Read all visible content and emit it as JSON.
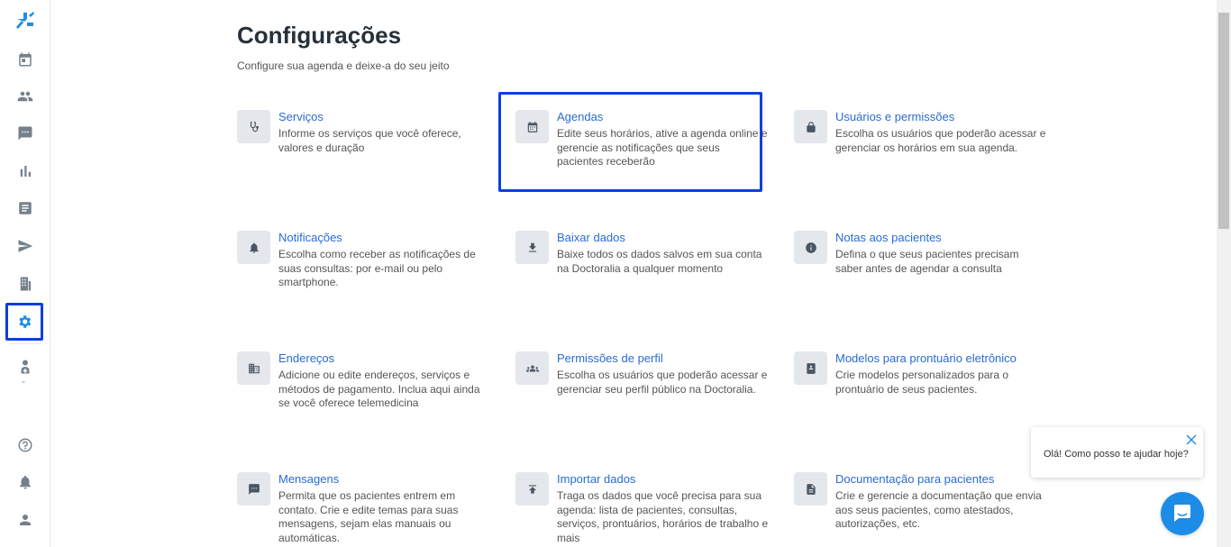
{
  "app": {
    "logo": "doctoralia-logo"
  },
  "sidebar": {
    "items": [
      {
        "icon": "logo-icon"
      },
      {
        "icon": "calendar-icon"
      },
      {
        "icon": "patients-icon"
      },
      {
        "icon": "messages-icon"
      },
      {
        "icon": "stats-icon"
      },
      {
        "icon": "records-icon"
      },
      {
        "icon": "send-icon"
      },
      {
        "icon": "building-icon"
      },
      {
        "icon": "settings-icon",
        "active": true
      },
      {
        "icon": "doctor-icon"
      },
      {
        "icon": "help-icon"
      },
      {
        "icon": "bell-icon"
      },
      {
        "icon": "user-icon"
      }
    ]
  },
  "page": {
    "title": "Configurações",
    "subtitle": "Configure sua agenda e deixe-a do seu jeito"
  },
  "cards": [
    {
      "title": "Serviços",
      "desc": "Informe os serviços que você oferece, valores e duração",
      "icon": "stethoscope-icon"
    },
    {
      "title": "Agendas",
      "desc": "Edite seus horários, ative a agenda online e gerencie as notificações que seus pacientes receberão",
      "icon": "calendar-icon"
    },
    {
      "title": "Usuários e permissões",
      "desc": "Escolha os usuários que poderão acessar e gerenciar os horários em sua agenda.",
      "icon": "lock-icon"
    },
    {
      "title": "Notificações",
      "desc": "Escolha como receber as notificações de suas consultas: por e-mail ou pelo smartphone.",
      "icon": "bell-icon"
    },
    {
      "title": "Baixar dados",
      "desc": "Baixe todos os dados salvos em sua conta na Doctoralia a qualquer momento",
      "icon": "download-icon"
    },
    {
      "title": "Notas aos pacientes",
      "desc": "Defina o que seus pacientes precisam saber antes de agendar a consulta",
      "icon": "info-icon"
    },
    {
      "title": "Endereços",
      "desc": "Adicione ou edite endereços, serviços e métodos de pagamento. Inclua aqui ainda se você oferece telemedicina",
      "icon": "building-icon"
    },
    {
      "title": "Permissões de perfil",
      "desc": "Escolha os usuários que poderão acessar e gerenciar seu perfil público na Doctoralia.",
      "icon": "group-icon"
    },
    {
      "title": "Modelos para prontuário eletrônico",
      "desc": "Crie modelos personalizados para o prontuário de seus pacientes.",
      "icon": "notebook-icon"
    },
    {
      "title": "Mensagens",
      "desc": "Permita que os pacientes entrem em contato. Crie e edite temas para suas mensagens, sejam elas manuais ou automáticas.",
      "icon": "chat-icon"
    },
    {
      "title": "Importar dados",
      "desc": "Traga os dados que você precisa para sua agenda: lista de pacientes, consultas, serviços, prontuários, horários de trabalho e mais",
      "icon": "upload-icon"
    },
    {
      "title": "Documentação para pacientes",
      "desc": "Crie e gerencie a documentação que envia aos seus pacientes, como atestados, autorizações, etc.",
      "icon": "document-icon"
    }
  ],
  "chat": {
    "message": "Olá! Como posso te ajudar hoje?"
  },
  "colors": {
    "accent": "#1d8ce6",
    "highlight": "#0b3fe0",
    "link": "#2a6bd1"
  }
}
